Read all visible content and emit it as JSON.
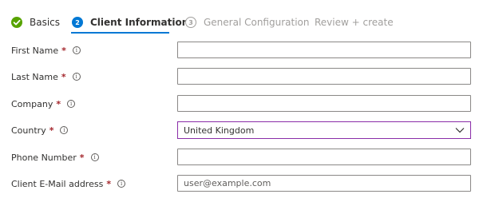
{
  "wizard": {
    "steps": [
      {
        "number": "",
        "label": "Basics",
        "state": "done"
      },
      {
        "number": "2",
        "label": "Client Information",
        "state": "active"
      },
      {
        "number": "3",
        "label": "General Configuration",
        "state": "disabled"
      },
      {
        "number": "",
        "label": "Review + create",
        "state": "disabled"
      }
    ]
  },
  "form": {
    "first_name": {
      "label": "First Name",
      "required_mark": "*",
      "value": "",
      "placeholder": ""
    },
    "last_name": {
      "label": "Last Name",
      "required_mark": "*",
      "value": "",
      "placeholder": ""
    },
    "company": {
      "label": "Company",
      "required_mark": "*",
      "value": "",
      "placeholder": ""
    },
    "country": {
      "label": "Country",
      "required_mark": "*",
      "selected": "United Kingdom"
    },
    "phone": {
      "label": "Phone Number",
      "required_mark": "*",
      "value": "",
      "placeholder": ""
    },
    "email": {
      "label": "Client E-Mail address",
      "required_mark": "*",
      "value": "",
      "placeholder": "user@example.com"
    },
    "info_glyph": "i"
  },
  "colors": {
    "accent": "#0078d4",
    "success": "#57a300",
    "required": "#a4262c",
    "focus_border": "#8a2da8",
    "disabled_text": "#a19f9d"
  }
}
